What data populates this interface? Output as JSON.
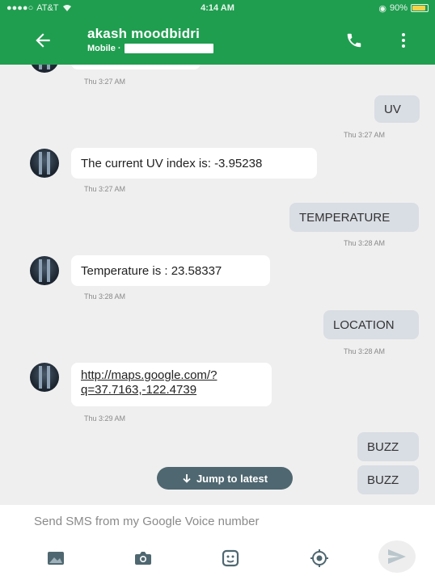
{
  "status_bar": {
    "carrier": "AT&T",
    "time": "4:14 AM",
    "battery": "90%",
    "battery_level": 0.9
  },
  "header": {
    "contact_name": "akash moodbidri",
    "subtitle": "Mobile ·",
    "back_icon": "arrow-left-icon",
    "call_icon": "phone-icon",
    "menu_icon": "more-vert-icon"
  },
  "messages": [
    {
      "direction": "incoming",
      "text": "",
      "time": "Thu 3:27 AM"
    },
    {
      "direction": "outgoing",
      "text": "UV",
      "time": "Thu 3:27 AM"
    },
    {
      "direction": "incoming",
      "text": "The current UV index is: -3.95238",
      "time": "Thu 3:27 AM"
    },
    {
      "direction": "outgoing",
      "text": "TEMPERATURE",
      "time": "Thu 3:28 AM"
    },
    {
      "direction": "incoming",
      "text": "Temperature is : 23.58337",
      "time": "Thu 3:28 AM"
    },
    {
      "direction": "outgoing",
      "text": "LOCATION",
      "time": "Thu 3:28 AM"
    },
    {
      "direction": "incoming",
      "text_line1": "http://maps.google.com/?",
      "text_line2": "q=37.7163,-122.4739",
      "time": "Thu 3:29 AM"
    },
    {
      "direction": "outgoing",
      "text": "BUZZ",
      "time": ""
    },
    {
      "direction": "outgoing",
      "text": "BUZZ",
      "time": ""
    }
  ],
  "jump_to_latest": "Jump to latest",
  "composer": {
    "placeholder": "Send SMS from my Google Voice number",
    "tools": [
      "image-icon",
      "camera-icon",
      "sticker-icon",
      "location-icon"
    ],
    "send_icon": "send-icon"
  },
  "colors": {
    "brand": "#1f9e4f",
    "incoming_bubble": "#ffffff",
    "outgoing_bubble": "#d9dde4",
    "background": "#efefef",
    "jump_pill": "#4f6770"
  }
}
